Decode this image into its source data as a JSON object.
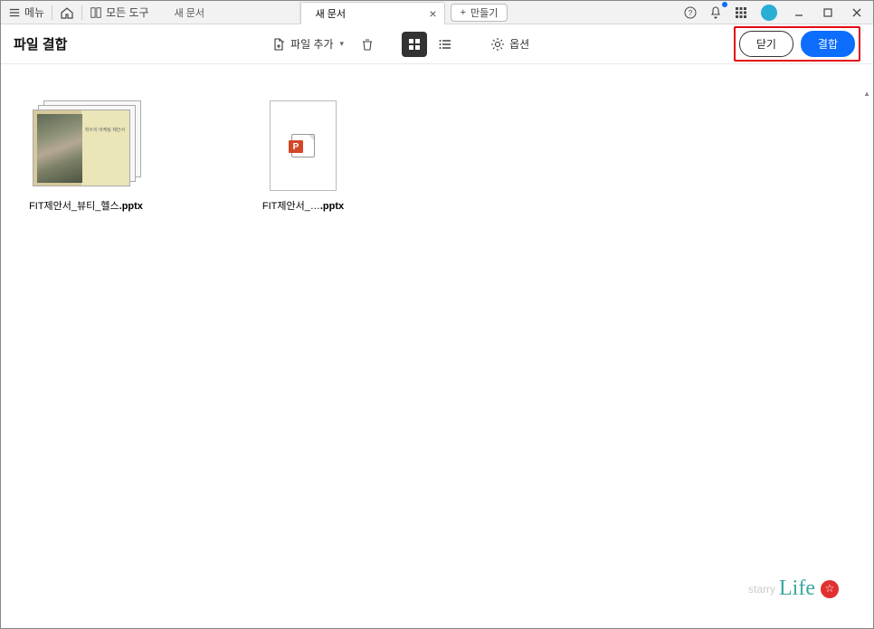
{
  "titlebar": {
    "menu_label": "메뉴",
    "all_tools_label": "모든 도구",
    "tabs": [
      {
        "label": "새 문서",
        "active": false
      },
      {
        "label": "새 문서",
        "active": true
      }
    ],
    "new_tab_btn": "만들기"
  },
  "toolbar": {
    "title": "파일 결합",
    "add_files": "파일 추가",
    "options_label": "옵션",
    "close_btn": "닫기",
    "combine_btn": "결합"
  },
  "files": [
    {
      "name_base": "FIT제안서_뷰티_헬스",
      "ext": ".pptx",
      "thumb_type": "stack",
      "thumb_small_text": "착수의\n마케팅 제안서"
    },
    {
      "name_base": "FIT제안서_…",
      "ext": ".pptx",
      "thumb_type": "single"
    }
  ],
  "watermark": {
    "pre_text": "starry",
    "text": "Life"
  }
}
